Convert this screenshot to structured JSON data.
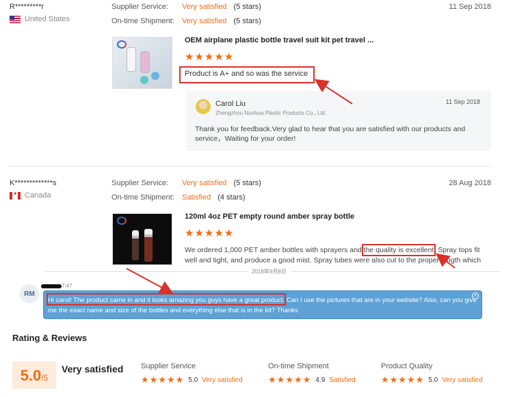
{
  "review1": {
    "buyer": "R*********r",
    "country": "United States",
    "supplier_service_label": "Supplier Service:",
    "supplier_service_value": "Very satisfied",
    "supplier_service_stars": "(5 stars)",
    "ontime_label": "On-time Shipment:",
    "ontime_value": "Very satisfied",
    "ontime_stars": "(5 stars)",
    "date": "11 Sep 2018",
    "product_title": "OEM airplane plastic bottle travel suit kit pet travel ...",
    "rating_stars": "★★★★★",
    "text": "Product is A+ and so was the service",
    "reply": {
      "name": "Carol Liu",
      "company": "Zhengzhou Nuohua Plastic Products Co., Ltd.",
      "date": "11 Sep 2018",
      "text": "Thank you for feedback.Very glad to hear that you are satisfied with our products and service，Waiting for your order!"
    }
  },
  "review2": {
    "buyer": "K*************s",
    "country": "Canada",
    "supplier_service_label": "Supplier Service:",
    "supplier_service_value": "Very satisfied",
    "supplier_service_stars": "(5 stars)",
    "ontime_label": "On-time Shipment:",
    "ontime_value": "Satisfied",
    "ontime_stars": "(4 stars)",
    "date": "28 Aug 2018",
    "product_title": "120ml 4oz PET empty round amber spray bottle",
    "rating_stars": "★★★★★",
    "text": "We ordered 1,000 PET amber bottles with sprayers and the quality is excellent. Spray tops fit well and tight, and produce a good mist. Spray tubes were also cut to the proper length which"
  },
  "chat": {
    "date_separator": "2018年9月8日",
    "avatar_initials": "RM",
    "time": "7:47",
    "message": "Hi carol! The product came in and it looks amazing you guys have a great product. Can I use the pictures that are in your website? Also, can you give me the exact name and size of the bottles and everything else that is in the kit? Thanks",
    "close_symbol": "×"
  },
  "summary": {
    "title": "Rating & Reviews",
    "score": "5.0",
    "score_max": "/5",
    "overall": "Very satisfied",
    "columns": [
      {
        "label": "Supplier Service",
        "stars": "★★★★★",
        "score": "5.0",
        "verdict": "Very satisfied"
      },
      {
        "label": "On-time Shipment",
        "stars": "★★★★★",
        "score": "4.9",
        "verdict": "Satisfied"
      },
      {
        "label": "Product Quality",
        "stars": "★★★★★",
        "score": "5.0",
        "verdict": "Very satisfied"
      }
    ]
  },
  "colors": {
    "accent": "#f36c13",
    "annotation_red": "#d9312b",
    "chat_bubble": "#5ea1d6"
  }
}
